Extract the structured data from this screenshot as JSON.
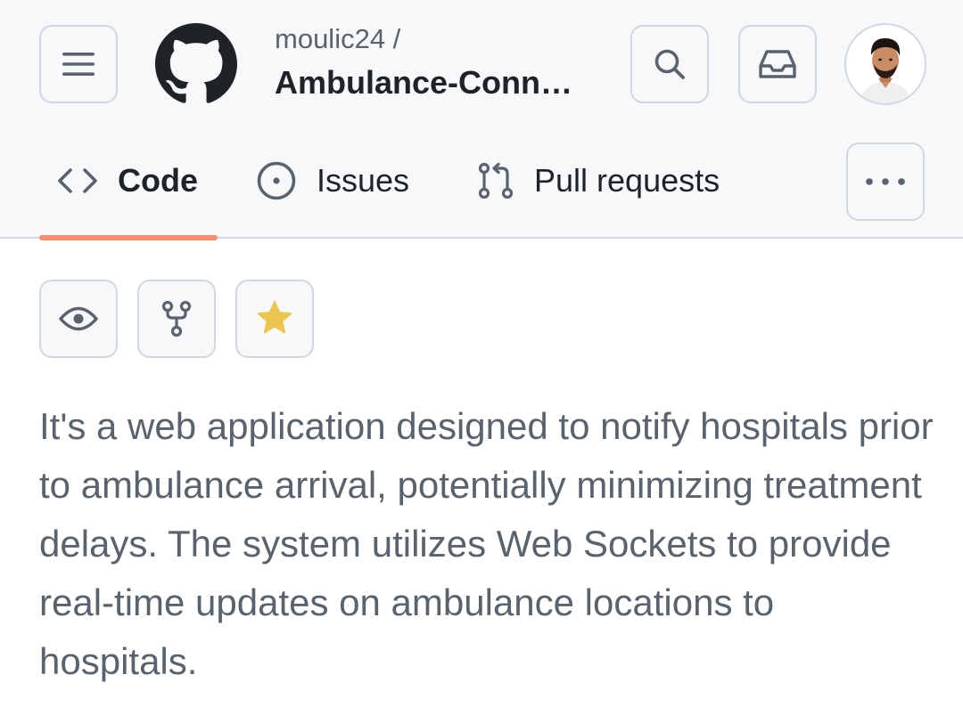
{
  "header": {
    "owner": "moulic24 /",
    "repo_name": "Ambulance-Conn…"
  },
  "icons": {
    "menu": "hamburger-menu-icon",
    "logo": "github-logo-icon",
    "search": "search-icon",
    "inbox": "inbox-icon",
    "more": "kebab-horizontal-icon",
    "code": "code-icon",
    "issues": "issue-opened-icon",
    "pulls": "git-pull-request-icon",
    "watch": "eye-icon",
    "fork": "repo-forked-icon",
    "star": "star-fill-icon"
  },
  "tabs": [
    {
      "label": "Code",
      "selected": true
    },
    {
      "label": "Issues",
      "selected": false
    },
    {
      "label": "Pull requests",
      "selected": false
    }
  ],
  "repo": {
    "description": "It's a web application designed to notify hospitals prior to ambulance arrival, potentially minimizing treatment delays. The system utilizes Web Sockets to provide real-time updates on ambulance locations to hospitals."
  },
  "colors": {
    "header_bg": "#f6f8fa",
    "border": "#d0d7de",
    "selected_tab_underline": "#fd8c73",
    "star": "#eac54f",
    "muted_text": "#59636e",
    "text": "#1f2328"
  }
}
